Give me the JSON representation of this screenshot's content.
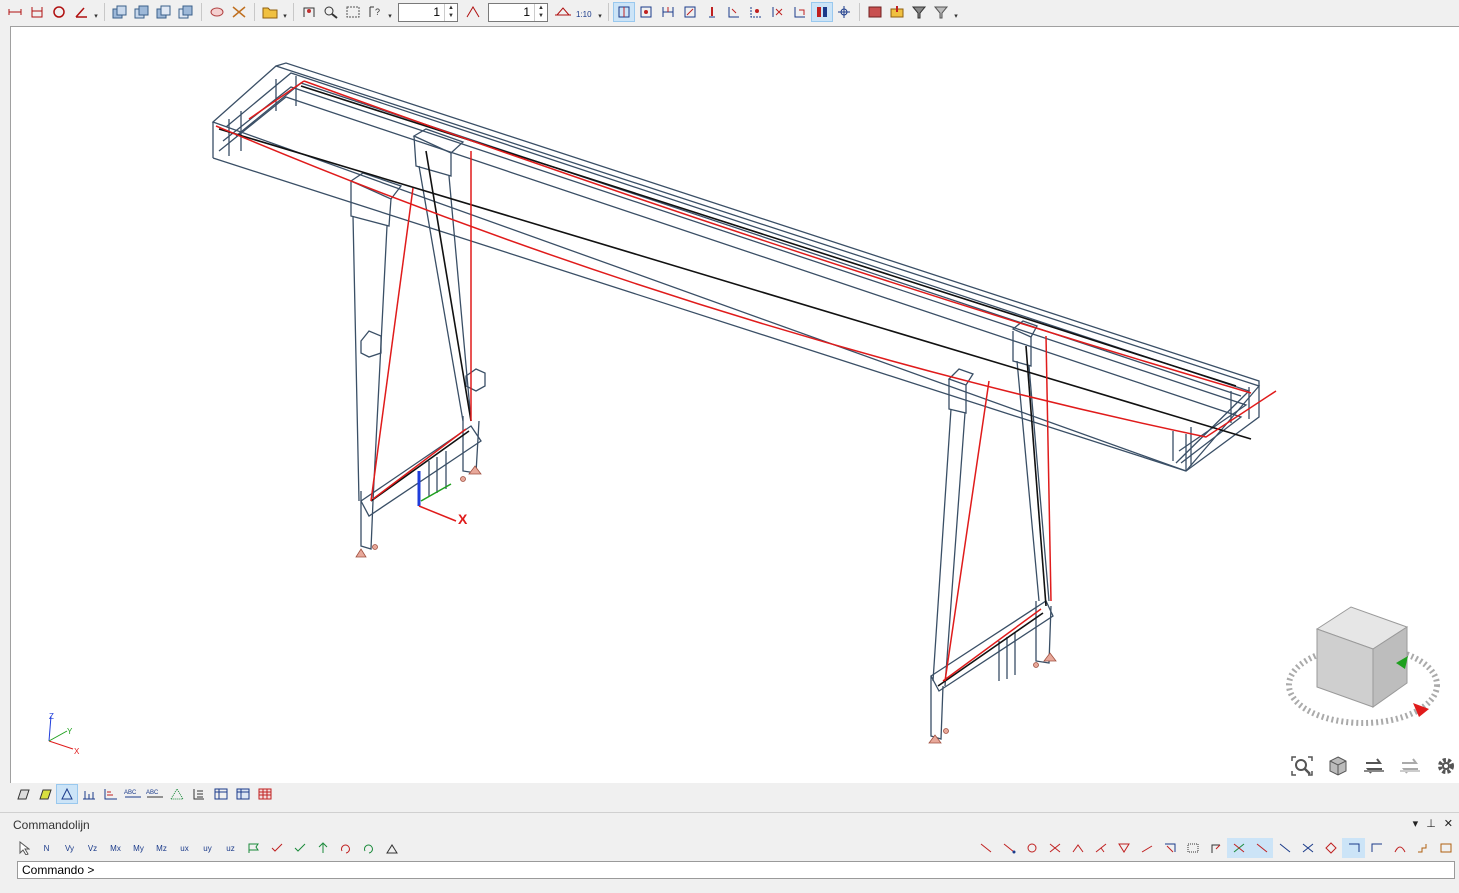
{
  "toolbar": {
    "spin1_value": "1",
    "spin2_value": "1",
    "scale_label": "1:10"
  },
  "view_strip": {
    "label_abc1": "ABC",
    "label_abc2": "ABC"
  },
  "command_panel": {
    "title": "Commandolijn",
    "pin_label": "⊥",
    "close_label": "✕",
    "dropdown_label": "▾",
    "prompt": "Commando >",
    "result_tools": [
      "N",
      "Vy",
      "Vz",
      "Mx",
      "My",
      "Mz",
      "ux",
      "uy",
      "uz"
    ]
  },
  "axes": {
    "x": "X",
    "y": "Y",
    "z": "Z"
  },
  "colors": {
    "frame": "#3a4f66",
    "deformed": "#e01b1b",
    "axis_line": "#111111",
    "accent": "#cce4f7"
  }
}
